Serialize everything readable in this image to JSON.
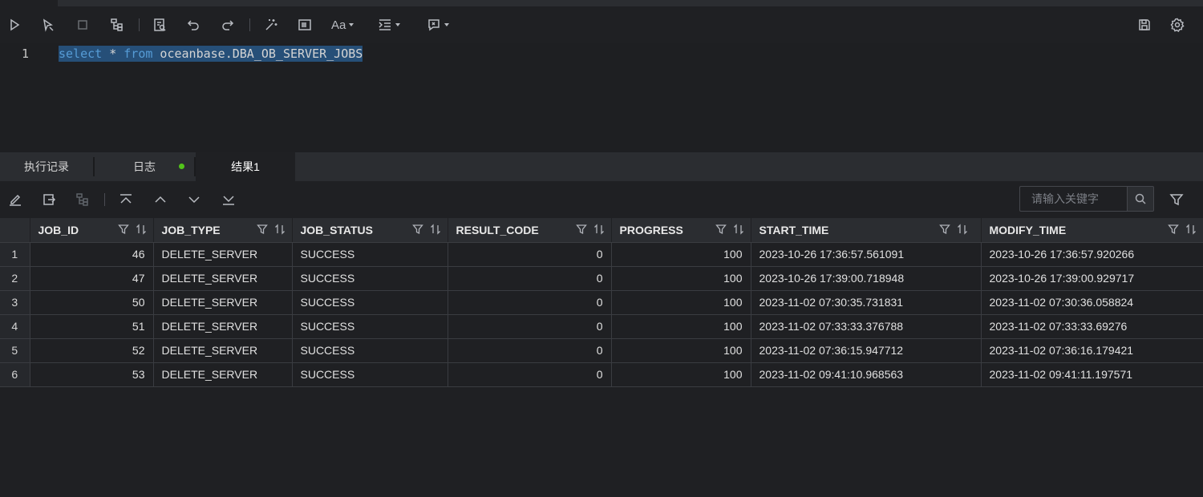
{
  "editor": {
    "line_number": "1",
    "sql": {
      "kw1": "select",
      "star": " * ",
      "kw2": "from",
      "rest": " oceanbase.DBA_OB_SERVER_JOBS"
    }
  },
  "toolbar": {
    "icons": [
      "run-icon",
      "run-selected-icon",
      "stop-icon",
      "explain-icon",
      "format-icon",
      "undo-icon",
      "redo-icon",
      "beautify-icon",
      "snippet-icon",
      "font-case-icon",
      "indent-icon",
      "comment-icon",
      "save-icon",
      "settings-icon"
    ]
  },
  "tabs": [
    {
      "label": "执行记录",
      "active": false
    },
    {
      "label": "日志",
      "active": false,
      "status_dot_color": "#52c41a"
    },
    {
      "label": "结果1",
      "active": true
    }
  ],
  "result_toolbar": {
    "search_placeholder": "请输入关键字"
  },
  "table": {
    "columns": [
      "JOB_ID",
      "JOB_TYPE",
      "JOB_STATUS",
      "RESULT_CODE",
      "PROGRESS",
      "START_TIME",
      "MODIFY_TIME"
    ],
    "rows": [
      {
        "n": "1",
        "cells": [
          "46",
          "DELETE_SERVER",
          "SUCCESS",
          "0",
          "100",
          "2023-10-26 17:36:57.561091",
          "2023-10-26 17:36:57.920266"
        ]
      },
      {
        "n": "2",
        "cells": [
          "47",
          "DELETE_SERVER",
          "SUCCESS",
          "0",
          "100",
          "2023-10-26 17:39:00.718948",
          "2023-10-26 17:39:00.929717"
        ]
      },
      {
        "n": "3",
        "cells": [
          "50",
          "DELETE_SERVER",
          "SUCCESS",
          "0",
          "100",
          "2023-11-02 07:30:35.731831",
          "2023-11-02 07:30:36.058824"
        ]
      },
      {
        "n": "4",
        "cells": [
          "51",
          "DELETE_SERVER",
          "SUCCESS",
          "0",
          "100",
          "2023-11-02 07:33:33.376788",
          "2023-11-02 07:33:33.69276"
        ]
      },
      {
        "n": "5",
        "cells": [
          "52",
          "DELETE_SERVER",
          "SUCCESS",
          "0",
          "100",
          "2023-11-02 07:36:15.947712",
          "2023-11-02 07:36:16.179421"
        ]
      },
      {
        "n": "6",
        "cells": [
          "53",
          "DELETE_SERVER",
          "SUCCESS",
          "0",
          "100",
          "2023-11-02 09:41:10.968563",
          "2023-11-02 09:41:11.197571"
        ]
      }
    ]
  }
}
